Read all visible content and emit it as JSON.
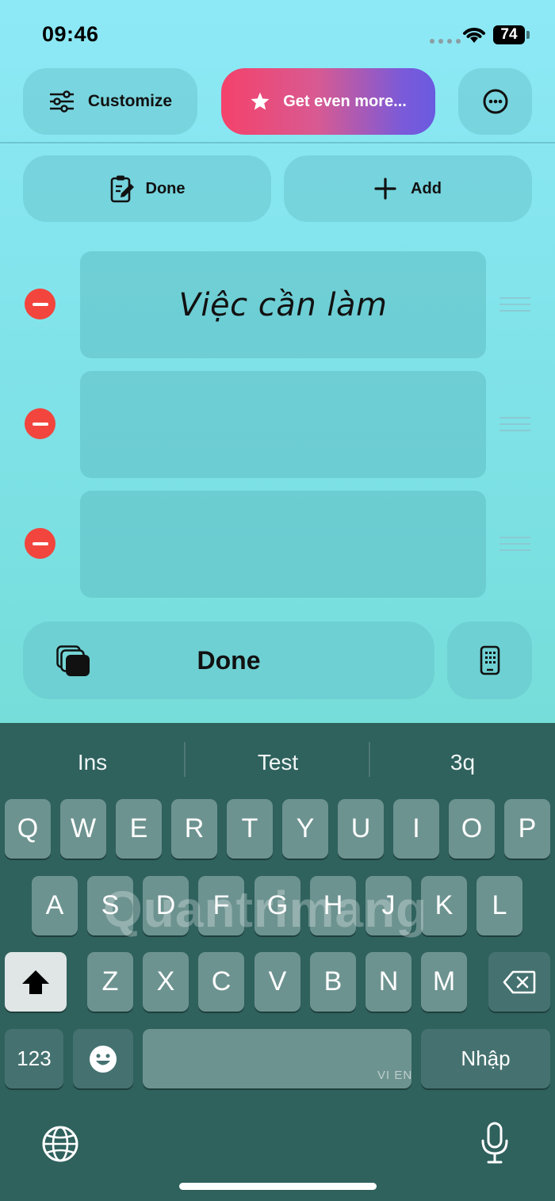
{
  "status": {
    "time": "09:46",
    "battery": "74"
  },
  "toolbar": {
    "customize_label": "Customize",
    "get_more_label": "Get even more...",
    "done_label": "Done",
    "add_label": "Add"
  },
  "items": [
    {
      "text": "Việc cần làm"
    },
    {
      "text": ""
    },
    {
      "text": ""
    }
  ],
  "main": {
    "done_label": "Done"
  },
  "keyboard": {
    "suggestions": [
      "Ins",
      "Test",
      "3q"
    ],
    "row1": [
      "Q",
      "W",
      "E",
      "R",
      "T",
      "Y",
      "U",
      "I",
      "O",
      "P"
    ],
    "row2": [
      "A",
      "S",
      "D",
      "F",
      "G",
      "H",
      "J",
      "K",
      "L"
    ],
    "row3": [
      "Z",
      "X",
      "C",
      "V",
      "B",
      "N",
      "M"
    ],
    "numbers_label": "123",
    "return_label": "Nhập",
    "space_label": "VI EN"
  },
  "watermark": "Quantrimang",
  "colors": {
    "accent_start": "#f4426b",
    "accent_end": "#6a5ae0",
    "remove": "#f2453d",
    "keyboard_bg": "#2f615d"
  }
}
